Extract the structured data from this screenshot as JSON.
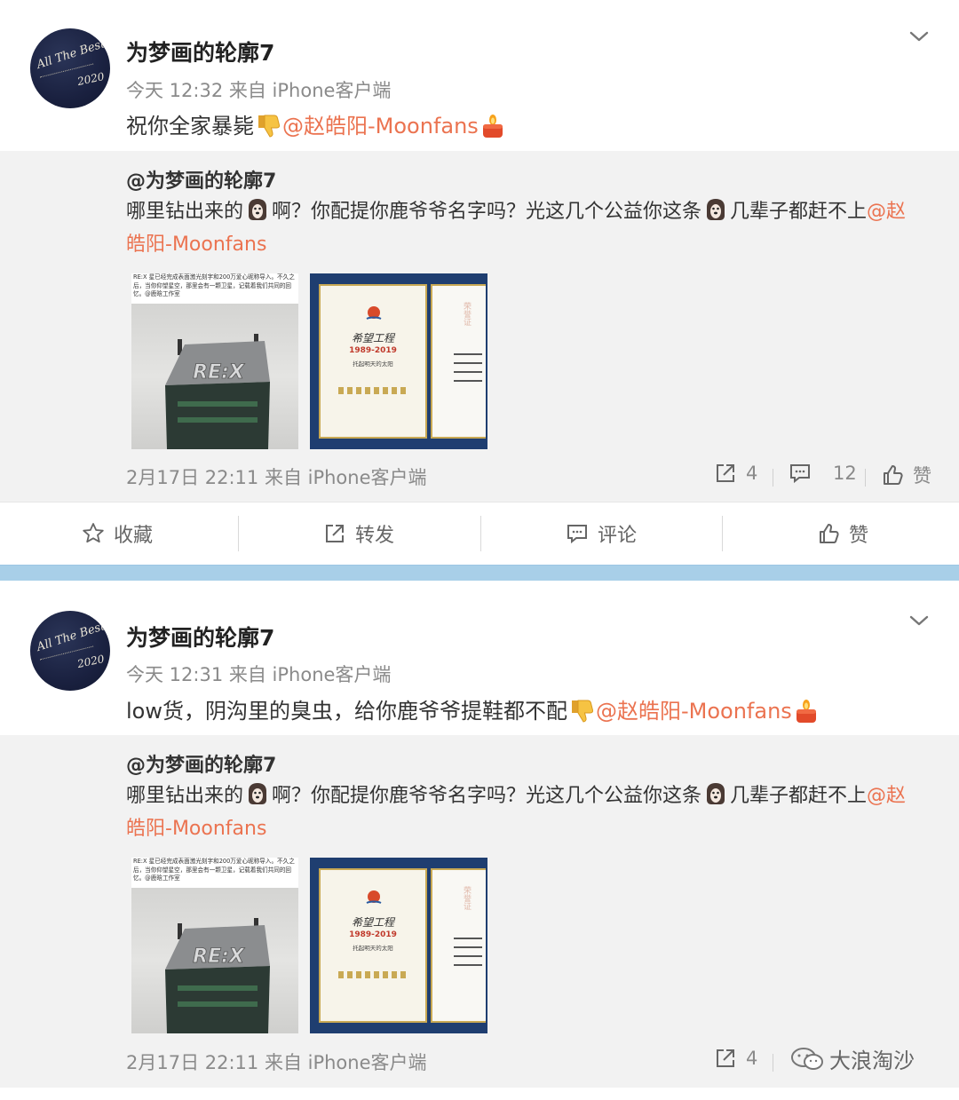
{
  "posts": [
    {
      "username": "为梦画的轮廓7",
      "meta": "今天 12:32 来自 iPhone客户端",
      "text_before": "祝你全家暴毙",
      "mention": "@赵皓阳-Moonfans",
      "avatar": {
        "line1": "All The Best",
        "line2": "2020"
      },
      "repost": {
        "user": "@为梦画的轮廓7",
        "text_a": "哪里钻出来的",
        "text_b": "啊？你配提你鹿爷爷名字吗？光这几个公益你这条",
        "text_c": "几辈子都赶不上",
        "mention": "@赵皓阳-Moonfans",
        "time": "2月17日 22:11 来自 iPhone客户端",
        "reposts": "4",
        "comments": "12",
        "like": "赞"
      }
    },
    {
      "username": "为梦画的轮廓7",
      "meta": "今天 12:31 来自 iPhone客户端",
      "text_before": "low货，阴沟里的臭虫，给你鹿爷爷提鞋都不配",
      "mention": "@赵皓阳-Moonfans",
      "avatar": {
        "line1": "All The Best",
        "line2": "2020"
      },
      "repost": {
        "user": "@为梦画的轮廓7",
        "text_a": "哪里钻出来的",
        "text_b": "啊？你配提你鹿爷爷名字吗？光这几个公益你这条",
        "text_c": "几辈子都赶不上",
        "mention": "@赵皓阳-Moonfans",
        "time": "2月17日 22:11 来自 iPhone客户端",
        "reposts": "4"
      }
    }
  ],
  "actions": {
    "favorite": "收藏",
    "forward": "转发",
    "comment": "评论",
    "like": "赞"
  },
  "thumb1": {
    "caption": "RE:X 星已经完成表面激光刻字和200万爱心昵称导入。不久之后，当你仰望星空，那里会有一颗卫星，记载着我们共同的回忆。@鹿晗工作室",
    "logo": "RE:X"
  },
  "thumb2": {
    "title": "希望工程",
    "years": "1989-2019",
    "sub": "托起明天的太阳",
    "seal": "荣誉证"
  },
  "watermark": "大浪淘沙",
  "colors": {
    "mention": "#eb7350",
    "band": "#a8cfe8",
    "repost_bg": "#f2f2f2"
  }
}
